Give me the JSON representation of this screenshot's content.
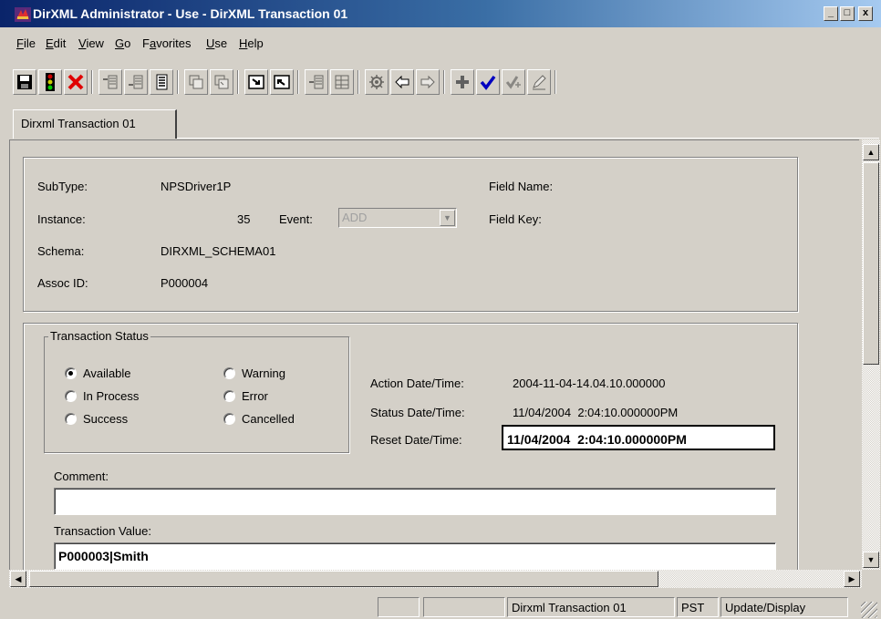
{
  "window": {
    "title": "DirXML Administrator - Use - DirXML Transaction 01",
    "controls": {
      "minimize": "_",
      "restore": "□",
      "close": "x"
    }
  },
  "menu": {
    "items": [
      {
        "label": "File",
        "mnemonic": "F"
      },
      {
        "label": "Edit",
        "mnemonic": "E"
      },
      {
        "label": "View",
        "mnemonic": "V"
      },
      {
        "label": "Go",
        "mnemonic": "G"
      },
      {
        "label": "Favorites",
        "mnemonic": "a"
      },
      {
        "label": "Use",
        "mnemonic": "U"
      },
      {
        "label": "Help",
        "mnemonic": "H"
      }
    ]
  },
  "toolbar": {
    "icons": [
      "save-icon",
      "traffic-light-icon",
      "cancel-icon",
      "insert-row-icon",
      "insert-row-before-icon",
      "list-view-icon",
      "copy-record-icon",
      "paste-record-icon",
      "go-next-icon",
      "go-previous-icon",
      "append-icon",
      "grid-view-icon",
      "process-gear-icon",
      "back-arrow-icon",
      "forward-arrow-icon",
      "add-plus-icon",
      "check-icon",
      "check-all-icon",
      "edit-pencil-icon"
    ]
  },
  "tabs": [
    {
      "label": "Dirxml Transaction 01",
      "active": true
    }
  ],
  "header_form": {
    "subtype_label": "SubType:",
    "subtype_value": "NPSDriver1P",
    "instance_label": "Instance:",
    "instance_value": "35",
    "event_label": "Event:",
    "event_value": "ADD",
    "schema_label": "Schema:",
    "schema_value": "DIRXML_SCHEMA01",
    "assoc_label": "Assoc ID:",
    "assoc_value": "P000004",
    "field_name_label": "Field Name:",
    "field_key_label": "Field Key:"
  },
  "status_form": {
    "group_title": "Transaction Status",
    "radios": [
      {
        "label": "Available",
        "checked": true
      },
      {
        "label": "In Process",
        "checked": false
      },
      {
        "label": "Success",
        "checked": false
      },
      {
        "label": "Warning",
        "checked": false
      },
      {
        "label": "Error",
        "checked": false
      },
      {
        "label": "Cancelled",
        "checked": false
      }
    ],
    "action_dt_label": "Action Date/Time:",
    "action_dt_value": "2004-11-04-14.04.10.000000",
    "status_dt_label": "Status Date/Time:",
    "status_dt_value": "11/04/2004  2:04:10.000000PM",
    "reset_dt_label": "Reset Date/Time:",
    "reset_dt_value": "11/04/2004  2:04:10.000000PM",
    "comment_label": "Comment:",
    "comment_value": "",
    "txn_value_label": "Transaction Value:",
    "txn_value": "P000003|Smith"
  },
  "statusbar": {
    "panel1": "",
    "panel2": "",
    "page": "Dirxml Transaction 01",
    "timezone": "PST",
    "mode": "Update/Display"
  },
  "colors": {
    "titlebar_start": "#0a246a",
    "titlebar_end": "#a6caf0",
    "face": "#d4d0c8"
  }
}
